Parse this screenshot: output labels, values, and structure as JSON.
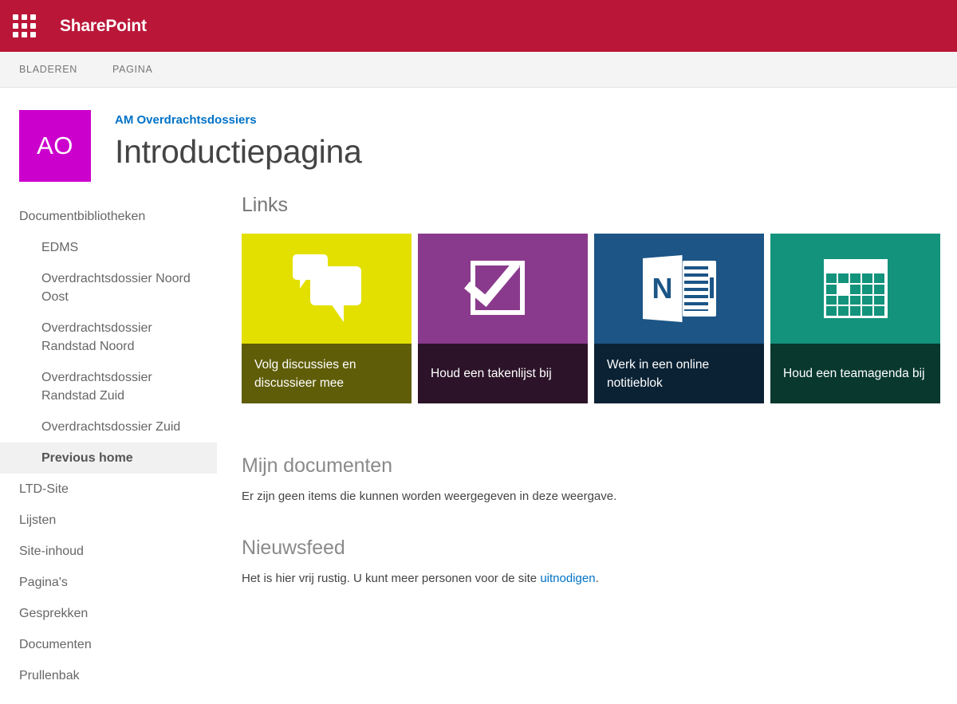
{
  "suite_bar": {
    "waffle_icon": "waffle-grid-icon",
    "brand": "SharePoint",
    "background": "#ba1638"
  },
  "ribbon": {
    "tabs": [
      {
        "label": "BLADEREN"
      },
      {
        "label": "PAGINA"
      }
    ]
  },
  "site_header": {
    "logo_initials": "AO",
    "logo_color": "#cc00cc",
    "site_name": "AM Overdrachtsdossiers",
    "page_title": "Introductiepagina"
  },
  "quick_launch": {
    "items": [
      {
        "label": "Documentbibliotheken",
        "level": 0,
        "selected": false
      },
      {
        "label": "EDMS",
        "level": 1,
        "selected": false
      },
      {
        "label": "Overdrachtsdossier Noord Oost",
        "level": 1,
        "selected": false
      },
      {
        "label": "Overdrachtsdossier Randstad Noord",
        "level": 1,
        "selected": false
      },
      {
        "label": "Overdrachtsdossier Randstad Zuid",
        "level": 1,
        "selected": false
      },
      {
        "label": "Overdrachtsdossier Zuid",
        "level": 1,
        "selected": false
      },
      {
        "label": "Previous home",
        "level": 1,
        "selected": true
      },
      {
        "label": "LTD-Site",
        "level": 0,
        "selected": false
      },
      {
        "label": "Lijsten",
        "level": 0,
        "selected": false
      },
      {
        "label": "Site-inhoud",
        "level": 0,
        "selected": false
      },
      {
        "label": "Pagina's",
        "level": 0,
        "selected": false
      },
      {
        "label": "Gesprekken",
        "level": 0,
        "selected": false
      },
      {
        "label": "Documenten",
        "level": 0,
        "selected": false
      },
      {
        "label": "Prullenbak",
        "level": 0,
        "selected": false
      }
    ]
  },
  "main": {
    "links_heading": "Links",
    "tiles": [
      {
        "caption": "Volg discussies en discussieer mee",
        "icon": "speech-bubbles-icon",
        "body_color": "#e3e000",
        "caption_color": "#5f5d07"
      },
      {
        "caption": "Houd een takenlijst bij",
        "icon": "checkbox-check-icon",
        "body_color": "#8a3a8c",
        "caption_color": "#2c1329"
      },
      {
        "caption": "Werk in een online notitieblok",
        "icon": "onenote-icon",
        "body_color": "#1c5586",
        "caption_color": "#0b2234"
      },
      {
        "caption": "Houd een teamagenda bij",
        "icon": "calendar-icon",
        "body_color": "#13937c",
        "caption_color": "#08382e"
      }
    ],
    "documents_heading": "Mijn documenten",
    "documents_empty_text": "Er zijn geen items die kunnen worden weergegeven in deze weergave.",
    "newsfeed_heading": "Nieuwsfeed",
    "newsfeed_text_before": "Het is hier vrij rustig. U kunt meer personen voor de site ",
    "newsfeed_link": "uitnodigen",
    "newsfeed_text_after": "."
  }
}
